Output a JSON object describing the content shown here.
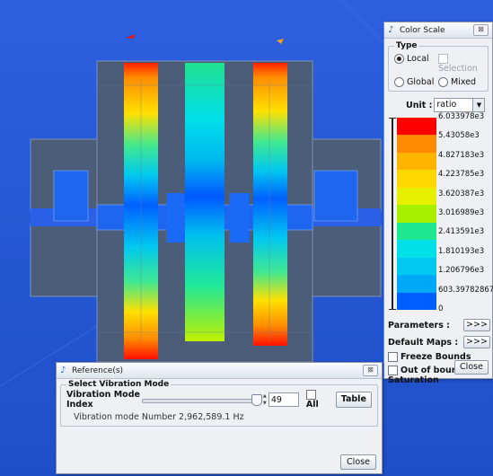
{
  "color_scale_panel": {
    "title": "Color Scale",
    "type_group": {
      "legend": "Type",
      "options": [
        {
          "label": "Local",
          "selected": true,
          "enabled": true
        },
        {
          "label": "Selection",
          "selected": false,
          "enabled": false
        },
        {
          "label": "Global",
          "selected": false,
          "enabled": true
        },
        {
          "label": "Mixed",
          "selected": false,
          "enabled": true
        }
      ]
    },
    "unit_label": "Unit :",
    "unit_value": "ratio",
    "scale_values": [
      "6.033978e3",
      "5.43058e3",
      "4.827183e3",
      "4.223785e3",
      "3.620387e3",
      "3.016989e3",
      "2.413591e3",
      "1.810193e3",
      "1.206796e3",
      "603.39782867",
      "0"
    ],
    "scale_colors": [
      "#ff0000",
      "#ff8a00",
      "#ffb400",
      "#ffd800",
      "#e6f000",
      "#a8f000",
      "#20e890",
      "#00e0e8",
      "#00c8f0",
      "#00a8f8",
      "#0060ff"
    ],
    "parameters_label": "Parameters :",
    "parameters_button": ">>>",
    "default_maps_label": "Default Maps :",
    "default_maps_button": ">>>",
    "freeze_bounds_label": "Freeze Bounds",
    "out_of_bounds_label": "Out of bounds Saturation",
    "close_label": "Close"
  },
  "reference_panel": {
    "title": "Reference(s)",
    "group_legend": "Select Vibration Mode",
    "mode_index_label": "Vibration Mode Index",
    "mode_index_value": "49",
    "all_label": "All",
    "table_label": "Table",
    "mode_info": "Vibration mode Number 2,962,589.1 Hz",
    "close_label": "Close"
  }
}
